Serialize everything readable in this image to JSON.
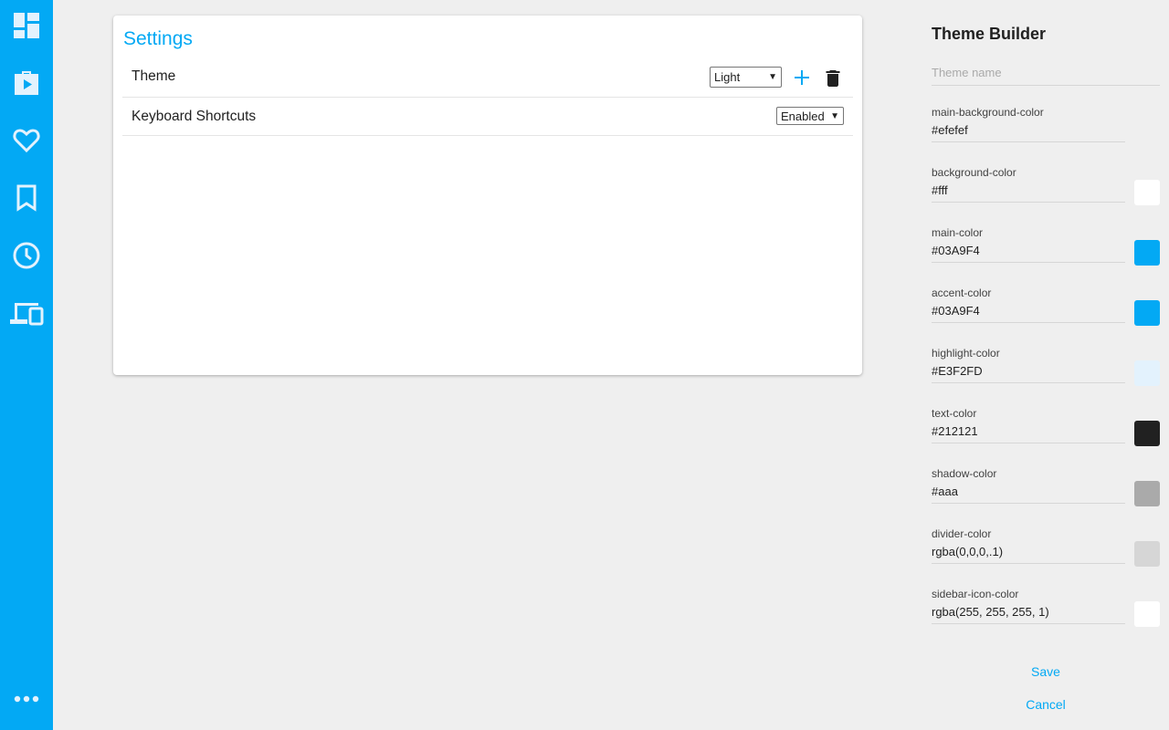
{
  "sidebar": {
    "items": [
      {
        "icon": "dashboard-icon"
      },
      {
        "icon": "play-store-icon"
      },
      {
        "icon": "heart-icon"
      },
      {
        "icon": "bookmark-icon"
      },
      {
        "icon": "clock-icon"
      },
      {
        "icon": "devices-icon"
      },
      {
        "icon": "more-icon"
      }
    ],
    "color": "#03A9F4"
  },
  "settings": {
    "title": "Settings",
    "rows": [
      {
        "label": "Theme",
        "select_value": "Light"
      },
      {
        "label": "Keyboard Shortcuts",
        "select_value": "Enabled"
      }
    ]
  },
  "builder": {
    "title": "Theme Builder",
    "name_placeholder": "Theme name",
    "fields": [
      {
        "label": "main-background-color",
        "value": "#efefef",
        "swatch": null
      },
      {
        "label": "background-color",
        "value": "#fff",
        "swatch": "#ffffff"
      },
      {
        "label": "main-color",
        "value": "#03A9F4",
        "swatch": "#03A9F4"
      },
      {
        "label": "accent-color",
        "value": "#03A9F4",
        "swatch": "#03A9F4"
      },
      {
        "label": "highlight-color",
        "value": "#E3F2FD",
        "swatch": "#E3F2FD"
      },
      {
        "label": "text-color",
        "value": "#212121",
        "swatch": "#212121"
      },
      {
        "label": "shadow-color",
        "value": "#aaa",
        "swatch": "#aaaaaa"
      },
      {
        "label": "divider-color",
        "value": "rgba(0,0,0,.1)",
        "swatch": "#d6d6d6"
      },
      {
        "label": "sidebar-icon-color",
        "value": "rgba(255, 255, 255, 1)",
        "swatch": "#ffffff"
      }
    ],
    "save_label": "Save",
    "cancel_label": "Cancel"
  }
}
